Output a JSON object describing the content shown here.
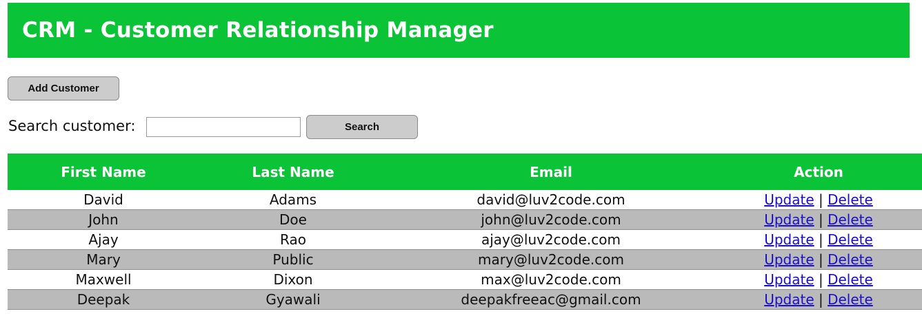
{
  "header": {
    "title": "CRM - Customer Relationship Manager"
  },
  "toolbar": {
    "add_label": "Add Customer",
    "search_label": "Search customer:",
    "search_value": "",
    "search_button_label": "Search"
  },
  "table": {
    "columns": [
      "First Name",
      "Last Name",
      "Email",
      "Action"
    ],
    "rows": [
      {
        "first": "David",
        "last": "Adams",
        "email": "david@luv2code.com"
      },
      {
        "first": "John",
        "last": "Doe",
        "email": "john@luv2code.com"
      },
      {
        "first": "Ajay",
        "last": "Rao",
        "email": "ajay@luv2code.com"
      },
      {
        "first": "Mary",
        "last": "Public",
        "email": "mary@luv2code.com"
      },
      {
        "first": "Maxwell",
        "last": "Dixon",
        "email": "max@luv2code.com"
      },
      {
        "first": "Deepak",
        "last": "Gyawali",
        "email": "deepakfreeac@gmail.com"
      }
    ],
    "update_label": "Update",
    "delete_label": "Delete",
    "separator": "|"
  },
  "colors": {
    "accent": "#0ac337",
    "alt_row": "#bababa",
    "link": "#1a0dcc"
  }
}
